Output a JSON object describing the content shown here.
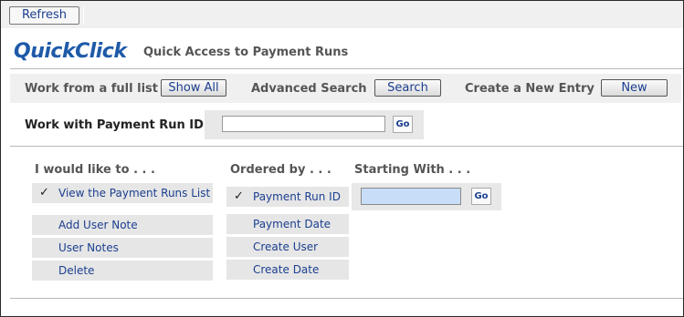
{
  "toolbar": {
    "refresh_label": "Refresh"
  },
  "header": {
    "logo": "QuickClick",
    "subtitle": "Quick Access to Payment Runs"
  },
  "row_actions": {
    "full_list_label": "Work from a full list",
    "show_all_label": "Show All",
    "advanced_search_label": "Advanced Search",
    "search_label": "Search",
    "new_entry_label": "Create a New Entry",
    "new_label": "New"
  },
  "id_row": {
    "label": "Work with Payment Run ID",
    "value": "",
    "go_label": "Go"
  },
  "columns": {
    "action_header": "I would like to . . .",
    "order_header": "Ordered by . . .",
    "start_header": "Starting With . . ."
  },
  "actions": [
    {
      "label": "View the Payment Runs List",
      "checked": "✓"
    },
    {
      "label": "Add User Note",
      "checked": ""
    },
    {
      "label": "User Notes",
      "checked": ""
    },
    {
      "label": "Delete",
      "checked": ""
    }
  ],
  "order_options": [
    {
      "label": "Payment Run ID",
      "checked": "✓"
    },
    {
      "label": "Payment Date",
      "checked": ""
    },
    {
      "label": "Create User",
      "checked": ""
    },
    {
      "label": "Create Date",
      "checked": ""
    }
  ],
  "start_with": {
    "value": "",
    "go_label": "Go"
  },
  "colors": {
    "accent": "#1e5aa8",
    "link": "#1b3f8f",
    "input_highlight": "#c8def8"
  }
}
